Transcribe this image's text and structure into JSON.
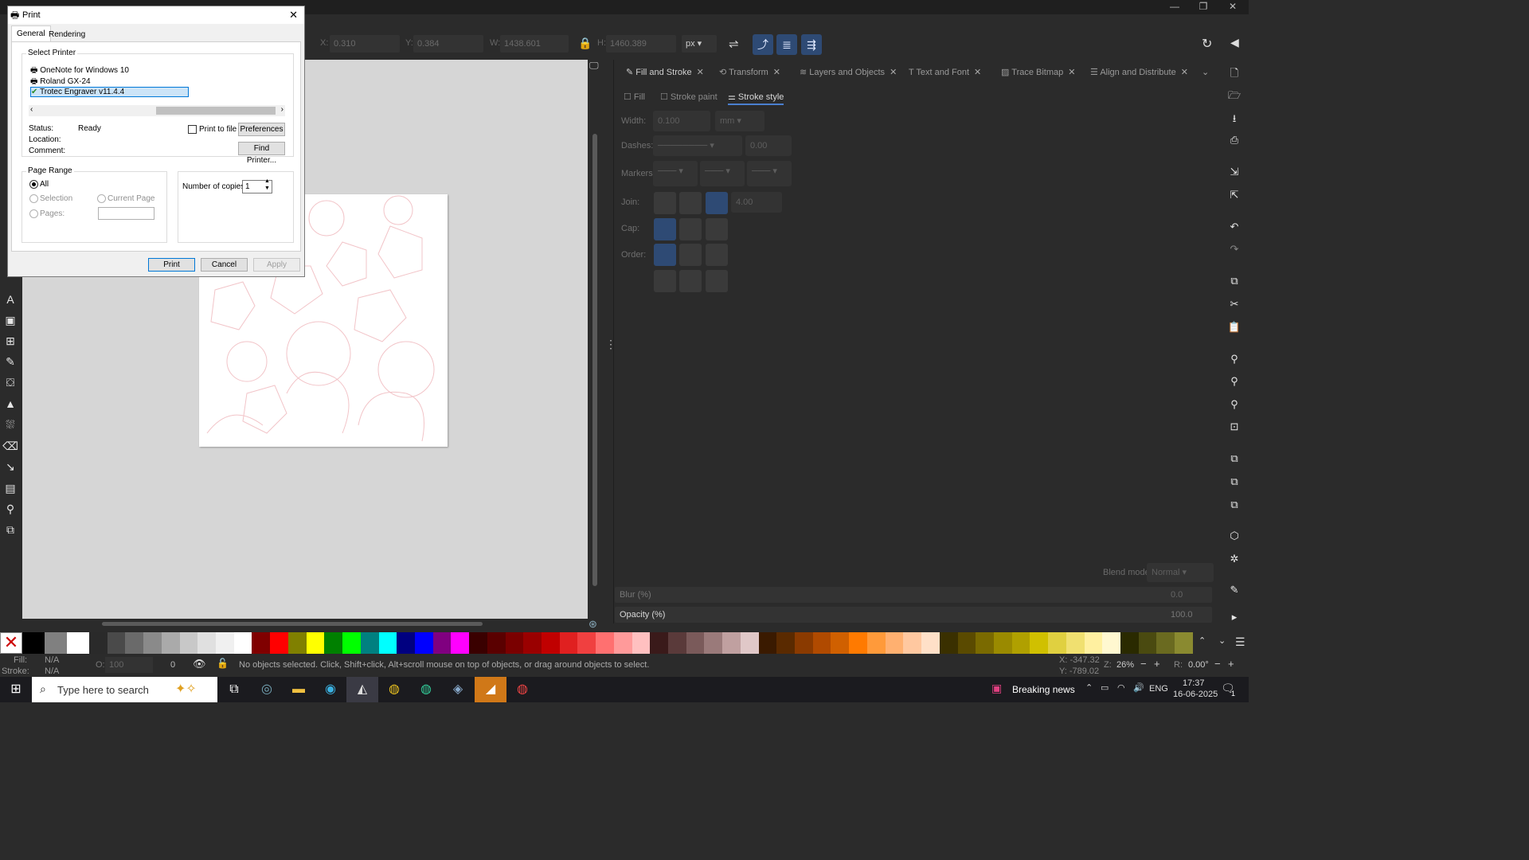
{
  "window": {
    "minimize": "—",
    "maximize": "❐",
    "close": "✕"
  },
  "toolbar": {
    "x_label": "X:",
    "x_value": "0.310",
    "y_label": "Y:",
    "y_value": "0.384",
    "w_label": "W:",
    "w_value": "1438.601",
    "h_label": "H:",
    "h_value": "1460.389",
    "unit": "px"
  },
  "panel": {
    "tabs": [
      {
        "label": "Fill and Stroke"
      },
      {
        "label": "Transform"
      },
      {
        "label": "Layers and Objects"
      },
      {
        "label": "Text and Font"
      },
      {
        "label": "Trace Bitmap"
      },
      {
        "label": "Align and Distribute"
      }
    ],
    "subtabs": [
      "Fill",
      "Stroke paint",
      "Stroke style"
    ],
    "width_label": "Width:",
    "width_value": "0.100",
    "width_unit": "mm",
    "dashes_label": "Dashes:",
    "dashes_value": "0.00",
    "markers_label": "Markers:",
    "join_label": "Join:",
    "join_value": "4.00",
    "cap_label": "Cap:",
    "order_label": "Order:",
    "blend_label": "Blend mode:",
    "blend_value": "Normal",
    "blur_label": "Blur (%)",
    "blur_value": "0.0",
    "opacity_label": "Opacity (%)",
    "opacity_value": "100.0"
  },
  "dialog": {
    "title": "Print",
    "tabs": [
      "General",
      "Rendering"
    ],
    "select_printer_label": "Select Printer",
    "printers": [
      "OneNote for Windows 10",
      "Roland GX-24",
      "Trotec Engraver v11.4.4"
    ],
    "status_label": "Status:",
    "status_value": "Ready",
    "location_label": "Location:",
    "comment_label": "Comment:",
    "print_to_file": "Print to file",
    "preferences": "Preferences",
    "find_printer": "Find Printer...",
    "page_range_label": "Page Range",
    "all": "All",
    "selection": "Selection",
    "current_page": "Current Page",
    "pages": "Pages:",
    "copies_label": "Number of copies:",
    "copies_value": "1",
    "print": "Print",
    "cancel": "Cancel",
    "apply": "Apply"
  },
  "status": {
    "fill_label": "Fill:",
    "fill_value": "N/A",
    "stroke_label": "Stroke:",
    "stroke_value": "N/A",
    "o_label": "O:",
    "o_value": "100",
    "layer_value": "0",
    "message": "No objects selected. Click, Shift+click, Alt+scroll mouse on top of objects, or drag around objects to select.",
    "x_coord": "X: -347.32",
    "y_coord": "Y: -789.02",
    "zoom_label": "Z:",
    "zoom": "26%",
    "rot_label": "R:",
    "rotation": "0.00°"
  },
  "taskbar": {
    "search_placeholder": "Type here to search",
    "news": "Breaking news",
    "lang": "ENG",
    "time": "17:37",
    "date": "16-06-2025",
    "notif": "1"
  },
  "palette": [
    "#000000",
    "#808080",
    "#ffffff",
    "#2a2a2a",
    "#4a4a4a",
    "#6a6a6a",
    "#8a8a8a",
    "#aaaaaa",
    "#c8c8c8",
    "#e0e0e0",
    "#f0f0f0",
    "#ffffff",
    "#800000",
    "#ff0000",
    "#808000",
    "#ffff00",
    "#008000",
    "#00ff00",
    "#008080",
    "#00ffff",
    "#000080",
    "#0000ff",
    "#800080",
    "#ff00ff",
    "#3a0000",
    "#5a0000",
    "#7a0000",
    "#9a0000",
    "#c00000",
    "#e02020",
    "#f04040",
    "#ff7070",
    "#ff9a9a",
    "#ffc0c0",
    "#3a1a1a",
    "#5a3a3a",
    "#7a5a5a",
    "#9a7a7a",
    "#c0a0a0",
    "#e0c8c8",
    "#3a1a00",
    "#5a2a00",
    "#8a3a00",
    "#b04a00",
    "#d06000",
    "#ff7a00",
    "#ff9a3a",
    "#ffb070",
    "#ffc8a0",
    "#ffe0c8",
    "#3a3000",
    "#5a4a00",
    "#7a6a00",
    "#9a8a00",
    "#b0a000",
    "#d0c000",
    "#e0d040",
    "#f0e070",
    "#fff0a0",
    "#fff8d0",
    "#2a2a00",
    "#4a4a10",
    "#6a6a20",
    "#8a8a30"
  ]
}
